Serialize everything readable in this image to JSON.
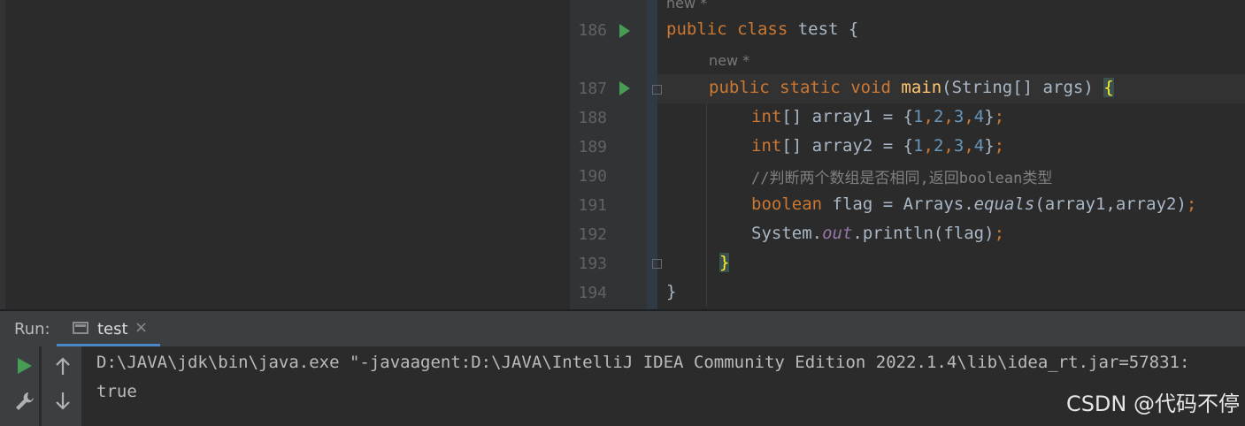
{
  "editor": {
    "hints": {
      "top": "new *",
      "method": "new *"
    },
    "line_numbers": [
      "186",
      "187",
      "188",
      "189",
      "190",
      "191",
      "192",
      "193",
      "194"
    ],
    "lines": {
      "l186": {
        "kw1": "public",
        "kw2": "class",
        "rest": " test {"
      },
      "l187": {
        "kw1": "public",
        "kw2": "static",
        "kw3": "void",
        "fn": "main",
        "rest": "(String[] args) ",
        "brace": "{"
      },
      "l188": {
        "kw": "int",
        "pre": "[] array1 = {",
        "n1": "1",
        "n2": "2",
        "n3": "3",
        "n4": "4",
        "post": "}",
        "semi": ";"
      },
      "l189": {
        "kw": "int",
        "pre": "[] array2 = {",
        "n1": "1",
        "n2": "2",
        "n3": "3",
        "n4": "4",
        "post": "}",
        "semi": ";"
      },
      "l190": {
        "comment": "//判断两个数组是否相同,返回boolean类型"
      },
      "l191": {
        "kw": "boolean",
        "pre": " flag = Arrays.",
        "method": "equals",
        "post": "(array1,array2)",
        "semi": ";"
      },
      "l192": {
        "pre": "System.",
        "field": "out",
        "post": ".println(flag)",
        "semi": ";"
      },
      "l193": {
        "brace": "}"
      },
      "l194": {
        "brace": "}"
      }
    }
  },
  "run_panel": {
    "label": "Run:",
    "tab_label": "test",
    "tab_close": "×",
    "tools": [
      "run-icon",
      "wrench-icon",
      "arrow-up-icon",
      "arrow-down-icon"
    ]
  },
  "console": {
    "line1": "D:\\JAVA\\jdk\\bin\\java.exe \"-javaagent:D:\\JAVA\\IntelliJ IDEA Community Edition 2022.1.4\\lib\\idea_rt.jar=57831:",
    "line2": "true"
  },
  "watermark": "CSDN @代码不停",
  "colors": {
    "keyword": "#cc7832",
    "function": "#ffc66d",
    "number": "#6897bb",
    "comment": "#808080",
    "static_field": "#9876aa",
    "run_green": "#499c54",
    "tab_accent": "#4a88c7"
  }
}
